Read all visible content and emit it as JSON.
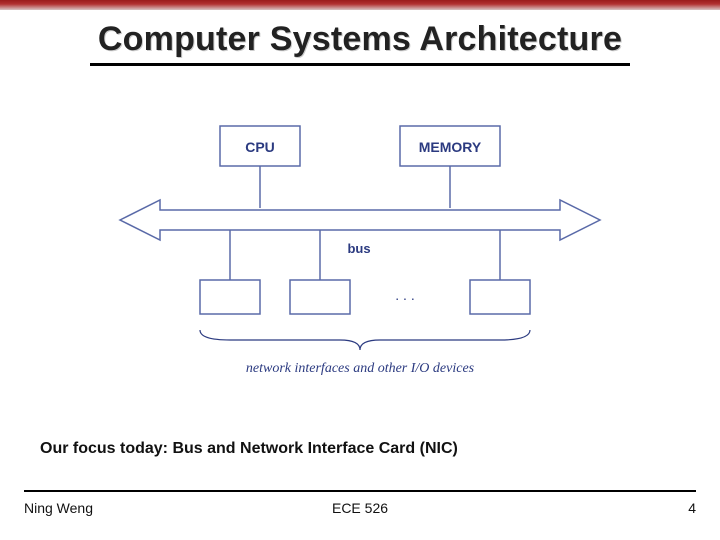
{
  "slide": {
    "title": "Computer Systems Architecture",
    "focus_line": "Our focus today: Bus and Network Interface Card (NIC)"
  },
  "diagram": {
    "cpu_label": "CPU",
    "memory_label": "MEMORY",
    "bus_label": "bus",
    "ellipsis": ". . .",
    "caption": "network interfaces and other I/O devices"
  },
  "footer": {
    "author": "Ning Weng",
    "course": "ECE 526",
    "page": "4"
  }
}
